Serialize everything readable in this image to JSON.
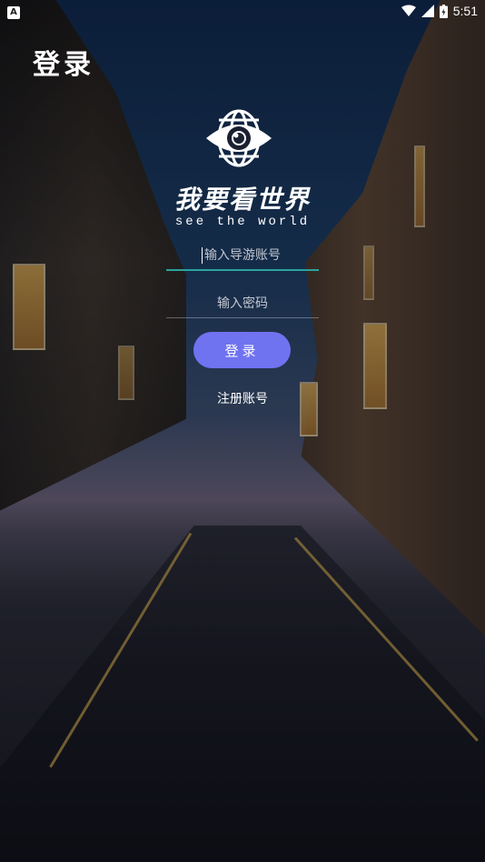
{
  "status_bar": {
    "left_badge": "A",
    "time": "5:51",
    "icons": [
      "wifi-icon",
      "signal-icon",
      "battery-charging-icon"
    ]
  },
  "header": {
    "title": "登录"
  },
  "logo": {
    "icon": "eye-globe-icon",
    "slogan_cn": "我要看世界",
    "slogan_en": "see the world"
  },
  "form": {
    "account_placeholder": "输入导游账号",
    "account_value": "",
    "password_placeholder": "输入密码",
    "password_value": "",
    "login_label": "登录",
    "register_label": "注册账号"
  },
  "colors": {
    "login_button": "#6f73f0",
    "account_underline": "#2aa49c",
    "text": "#ffffff"
  }
}
